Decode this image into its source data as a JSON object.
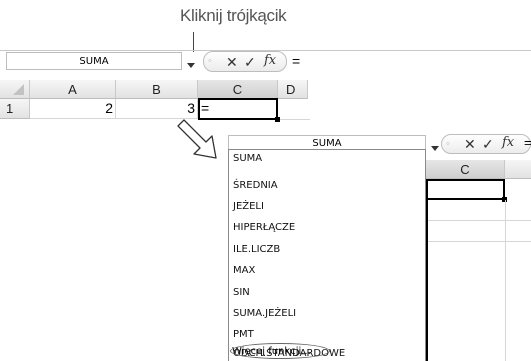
{
  "callout": {
    "text": "Kliknij trójkącik"
  },
  "top_excel": {
    "name_box": "SUMA",
    "fx_label": "fx",
    "formula_text": "=",
    "columns": [
      "A",
      "B",
      "C",
      "D"
    ],
    "row_number": "1",
    "cells": {
      "A1": "2",
      "B1": "3",
      "C1": "="
    }
  },
  "second_excel": {
    "name_box": "SUMA",
    "fx_label": "fx",
    "formula_text": "=",
    "column": "C",
    "cell_text": "="
  },
  "icons": {
    "dropdown": "triangle-down-icon",
    "cancel": "cross-icon",
    "enter": "checkmark-icon",
    "insert_function": "fx-icon",
    "pointer": "hollow-arrow-icon"
  },
  "function_list": [
    "SUMA",
    "ŚREDNIA",
    "JEŻELI",
    "HIPERŁĄCZE",
    "ILE.LICZB",
    "MAX",
    "SIN",
    "SUMA.JEŻELI",
    "PMT",
    "ODCH.STANDARDOWE"
  ],
  "more_functions": "Więcej funkcji..."
}
